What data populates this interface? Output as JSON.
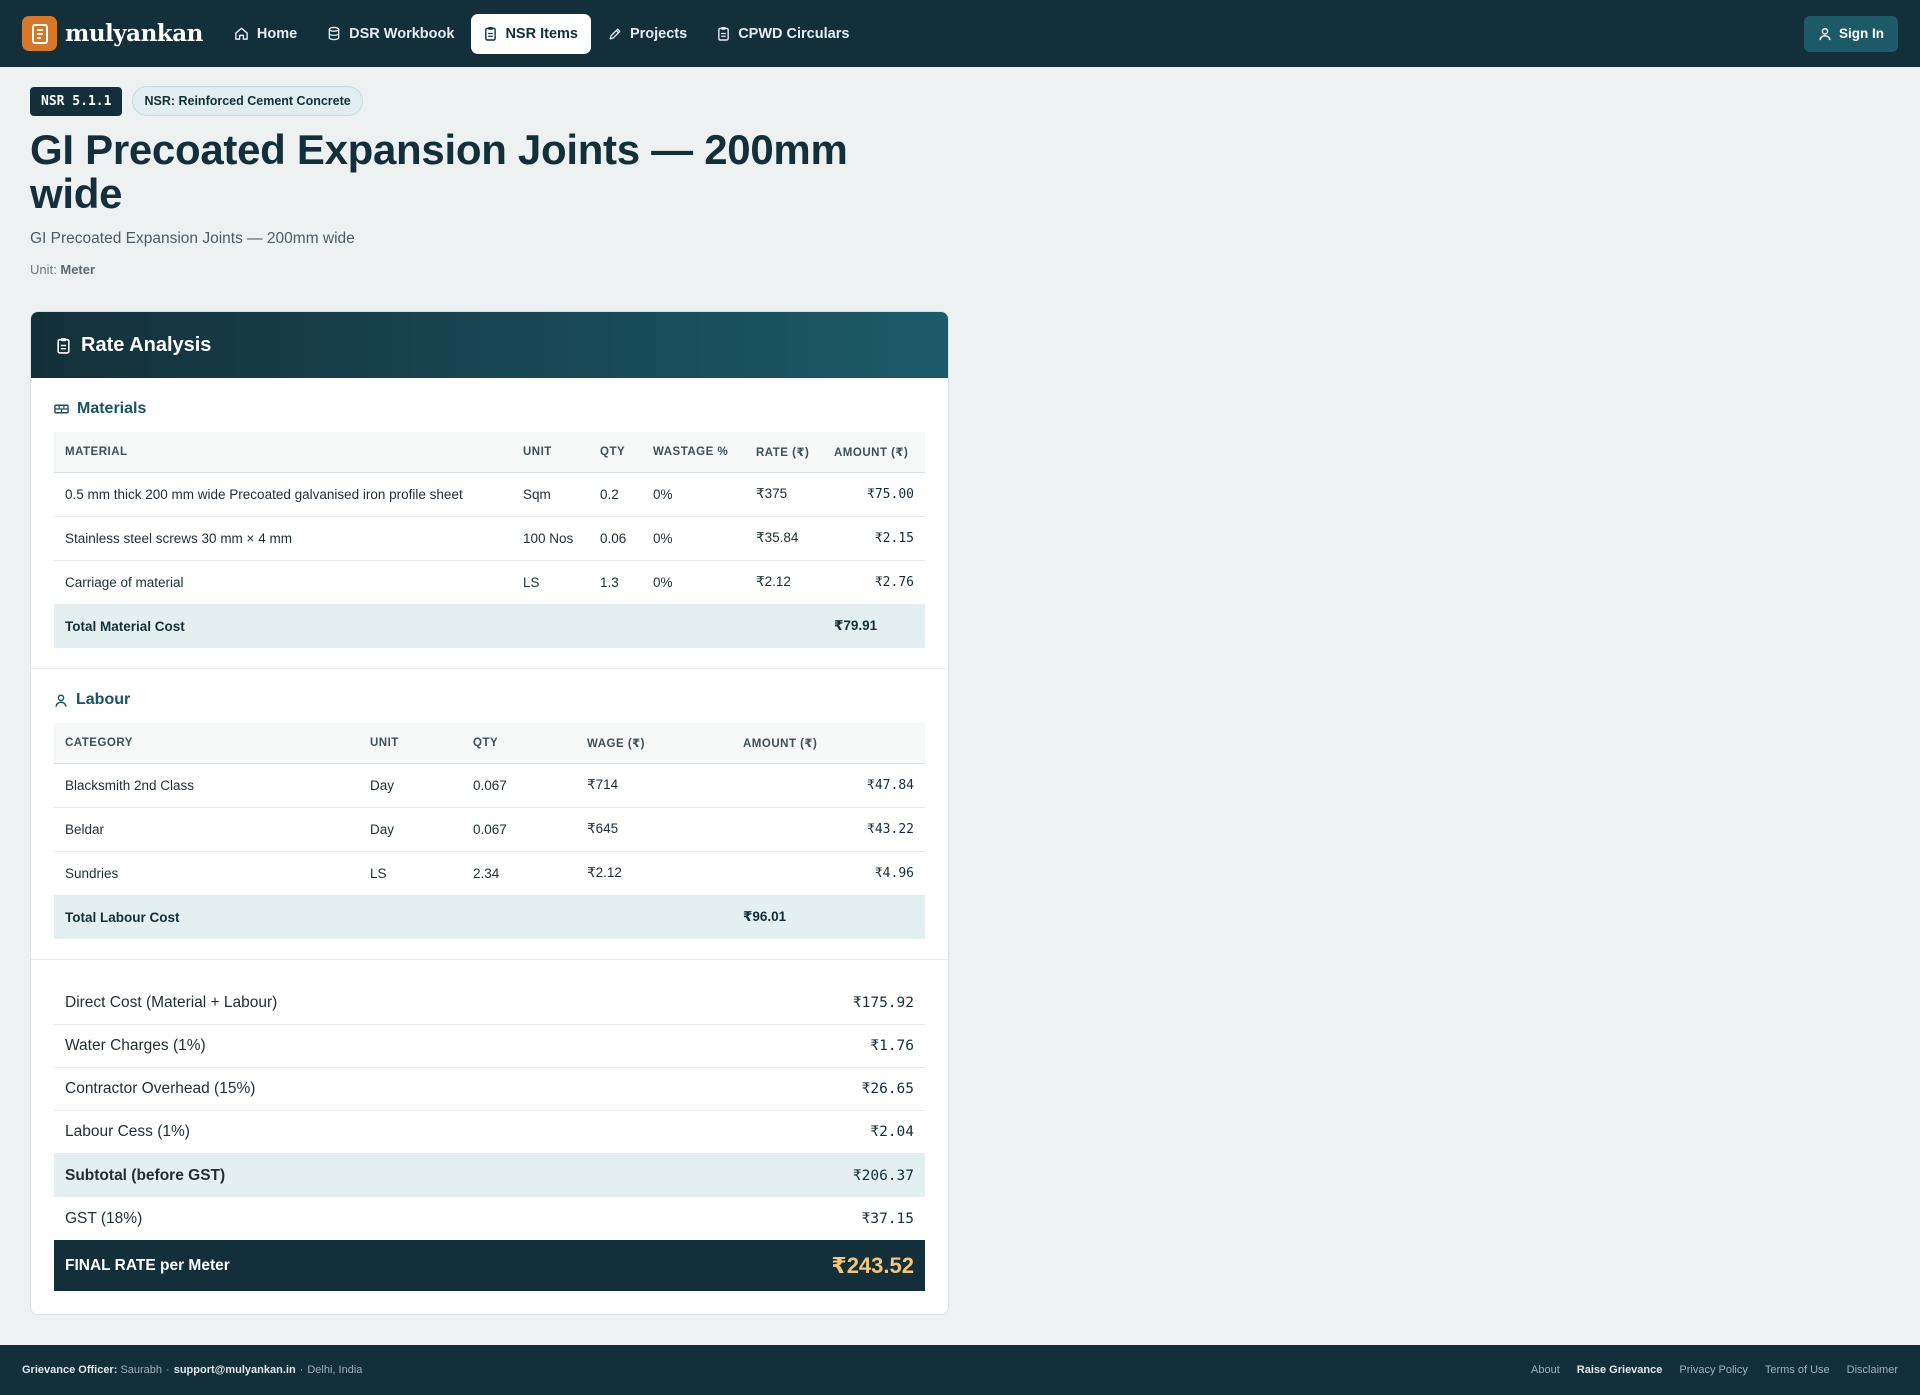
{
  "brand": {
    "name": "mulyankan",
    "logo_icon": "ledger-icon",
    "accent": "#d6782a"
  },
  "nav": {
    "items": [
      {
        "label": "Home",
        "icon": "home-icon",
        "active": false
      },
      {
        "label": "DSR Workbook",
        "icon": "database-icon",
        "active": false
      },
      {
        "label": "NSR Items",
        "icon": "clipboard-icon",
        "active": true
      },
      {
        "label": "Projects",
        "icon": "pencil-icon",
        "active": false
      },
      {
        "label": "CPWD Circulars",
        "icon": "document-icon",
        "active": false
      }
    ],
    "signin_label": "Sign In"
  },
  "item": {
    "code": "NSR 5.1.1",
    "category": "NSR: Reinforced Cement Concrete",
    "title": "GI Precoated Expansion Joints — 200mm wide",
    "subtitle": "GI Precoated Expansion Joints — 200mm wide",
    "unit_label": "Unit:",
    "unit_value": "Meter"
  },
  "rate_analysis": {
    "title": "Rate Analysis",
    "materials": {
      "title": "Materials",
      "headers": [
        "MATERIAL",
        "UNIT",
        "QTY",
        "WASTAGE %",
        "RATE (₹)",
        "AMOUNT (₹)"
      ],
      "rows": [
        {
          "material": "0.5 mm thick 200 mm wide Precoated galvanised iron profile sheet",
          "unit": "Sqm",
          "qty": "0.2",
          "wastage": "0%",
          "rate": "₹375",
          "amount": "₹75.00"
        },
        {
          "material": "Stainless steel screws 30 mm × 4 mm",
          "unit": "100 Nos",
          "qty": "0.06",
          "wastage": "0%",
          "rate": "₹35.84",
          "amount": "₹2.15"
        },
        {
          "material": "Carriage of material",
          "unit": "LS",
          "qty": "1.3",
          "wastage": "0%",
          "rate": "₹2.12",
          "amount": "₹2.76"
        }
      ],
      "total_label": "Total Material Cost",
      "total_value": "₹79.91"
    },
    "labour": {
      "title": "Labour",
      "headers": [
        "CATEGORY",
        "UNIT",
        "QTY",
        "WAGE (₹)",
        "AMOUNT (₹)"
      ],
      "rows": [
        {
          "category": "Blacksmith 2nd Class",
          "unit": "Day",
          "qty": "0.067",
          "wage": "₹714",
          "amount": "₹47.84"
        },
        {
          "category": "Beldar",
          "unit": "Day",
          "qty": "0.067",
          "wage": "₹645",
          "amount": "₹43.22"
        },
        {
          "category": "Sundries",
          "unit": "LS",
          "qty": "2.34",
          "wage": "₹2.12",
          "amount": "₹4.96"
        }
      ],
      "total_label": "Total Labour Cost",
      "total_value": "₹96.01"
    },
    "summary": [
      {
        "label": "Direct Cost (Material + Labour)",
        "value": "₹175.92"
      },
      {
        "label": "Water Charges (1%)",
        "value": "₹1.76"
      },
      {
        "label": "Contractor Overhead (15%)",
        "value": "₹26.65"
      },
      {
        "label": "Labour Cess (1%)",
        "value": "₹2.04"
      },
      {
        "label": "Subtotal (before GST)",
        "value": "₹206.37"
      },
      {
        "label": "GST (18%)",
        "value": "₹37.15"
      }
    ],
    "final_label": "FINAL RATE per Meter",
    "final_value": "₹243.52"
  },
  "footer": {
    "officer_label": "Grievance Officer:",
    "officer_name": "Saurabh",
    "email": "support@mulyankan.in",
    "location": "Delhi, India",
    "links": [
      "About",
      "Raise Grievance",
      "Privacy Policy",
      "Terms of Use",
      "Disclaimer"
    ]
  },
  "colors": {
    "navy": "#13303a",
    "teal": "#1c5a69",
    "gold": "#f5c67a",
    "highlight": "#e3eff1"
  }
}
